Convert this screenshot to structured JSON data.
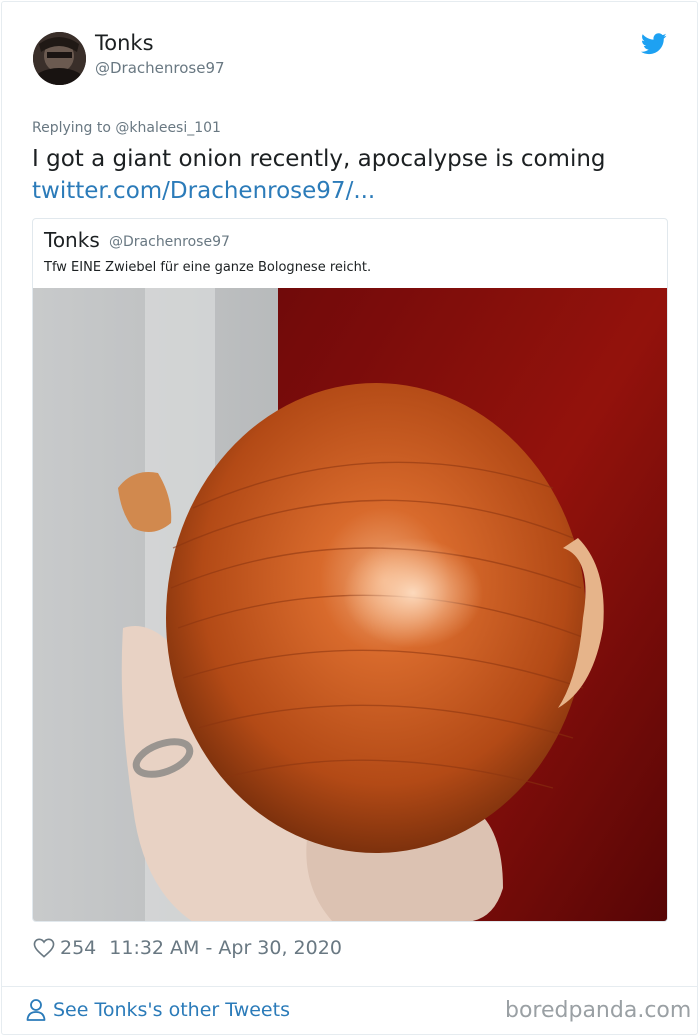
{
  "author": {
    "display_name": "Tonks",
    "handle": "@Drachenrose97"
  },
  "tweet": {
    "reply_label": "Replying to @khaleesi_101",
    "text": "I got a giant onion recently, apocalypse is coming",
    "link": "twitter.com/Drachenrose97/..."
  },
  "quoted_tweet": {
    "display_name": "Tonks",
    "handle": "@Drachenrose97",
    "text": "Tfw EINE Zwiebel für eine ganze Bolognese reicht."
  },
  "meta": {
    "like_count": "254",
    "timestamp": "11:32 AM - Apr 30, 2020"
  },
  "footer": {
    "see_other": "See Tonks's other Tweets",
    "watermark": "boredpanda.com"
  },
  "icons": {
    "brand": "twitter-bird-icon",
    "like": "heart-icon",
    "profile": "person-icon"
  },
  "colors": {
    "link": "#2b7bb9",
    "muted": "#697882",
    "brand": "#1da1f2"
  }
}
